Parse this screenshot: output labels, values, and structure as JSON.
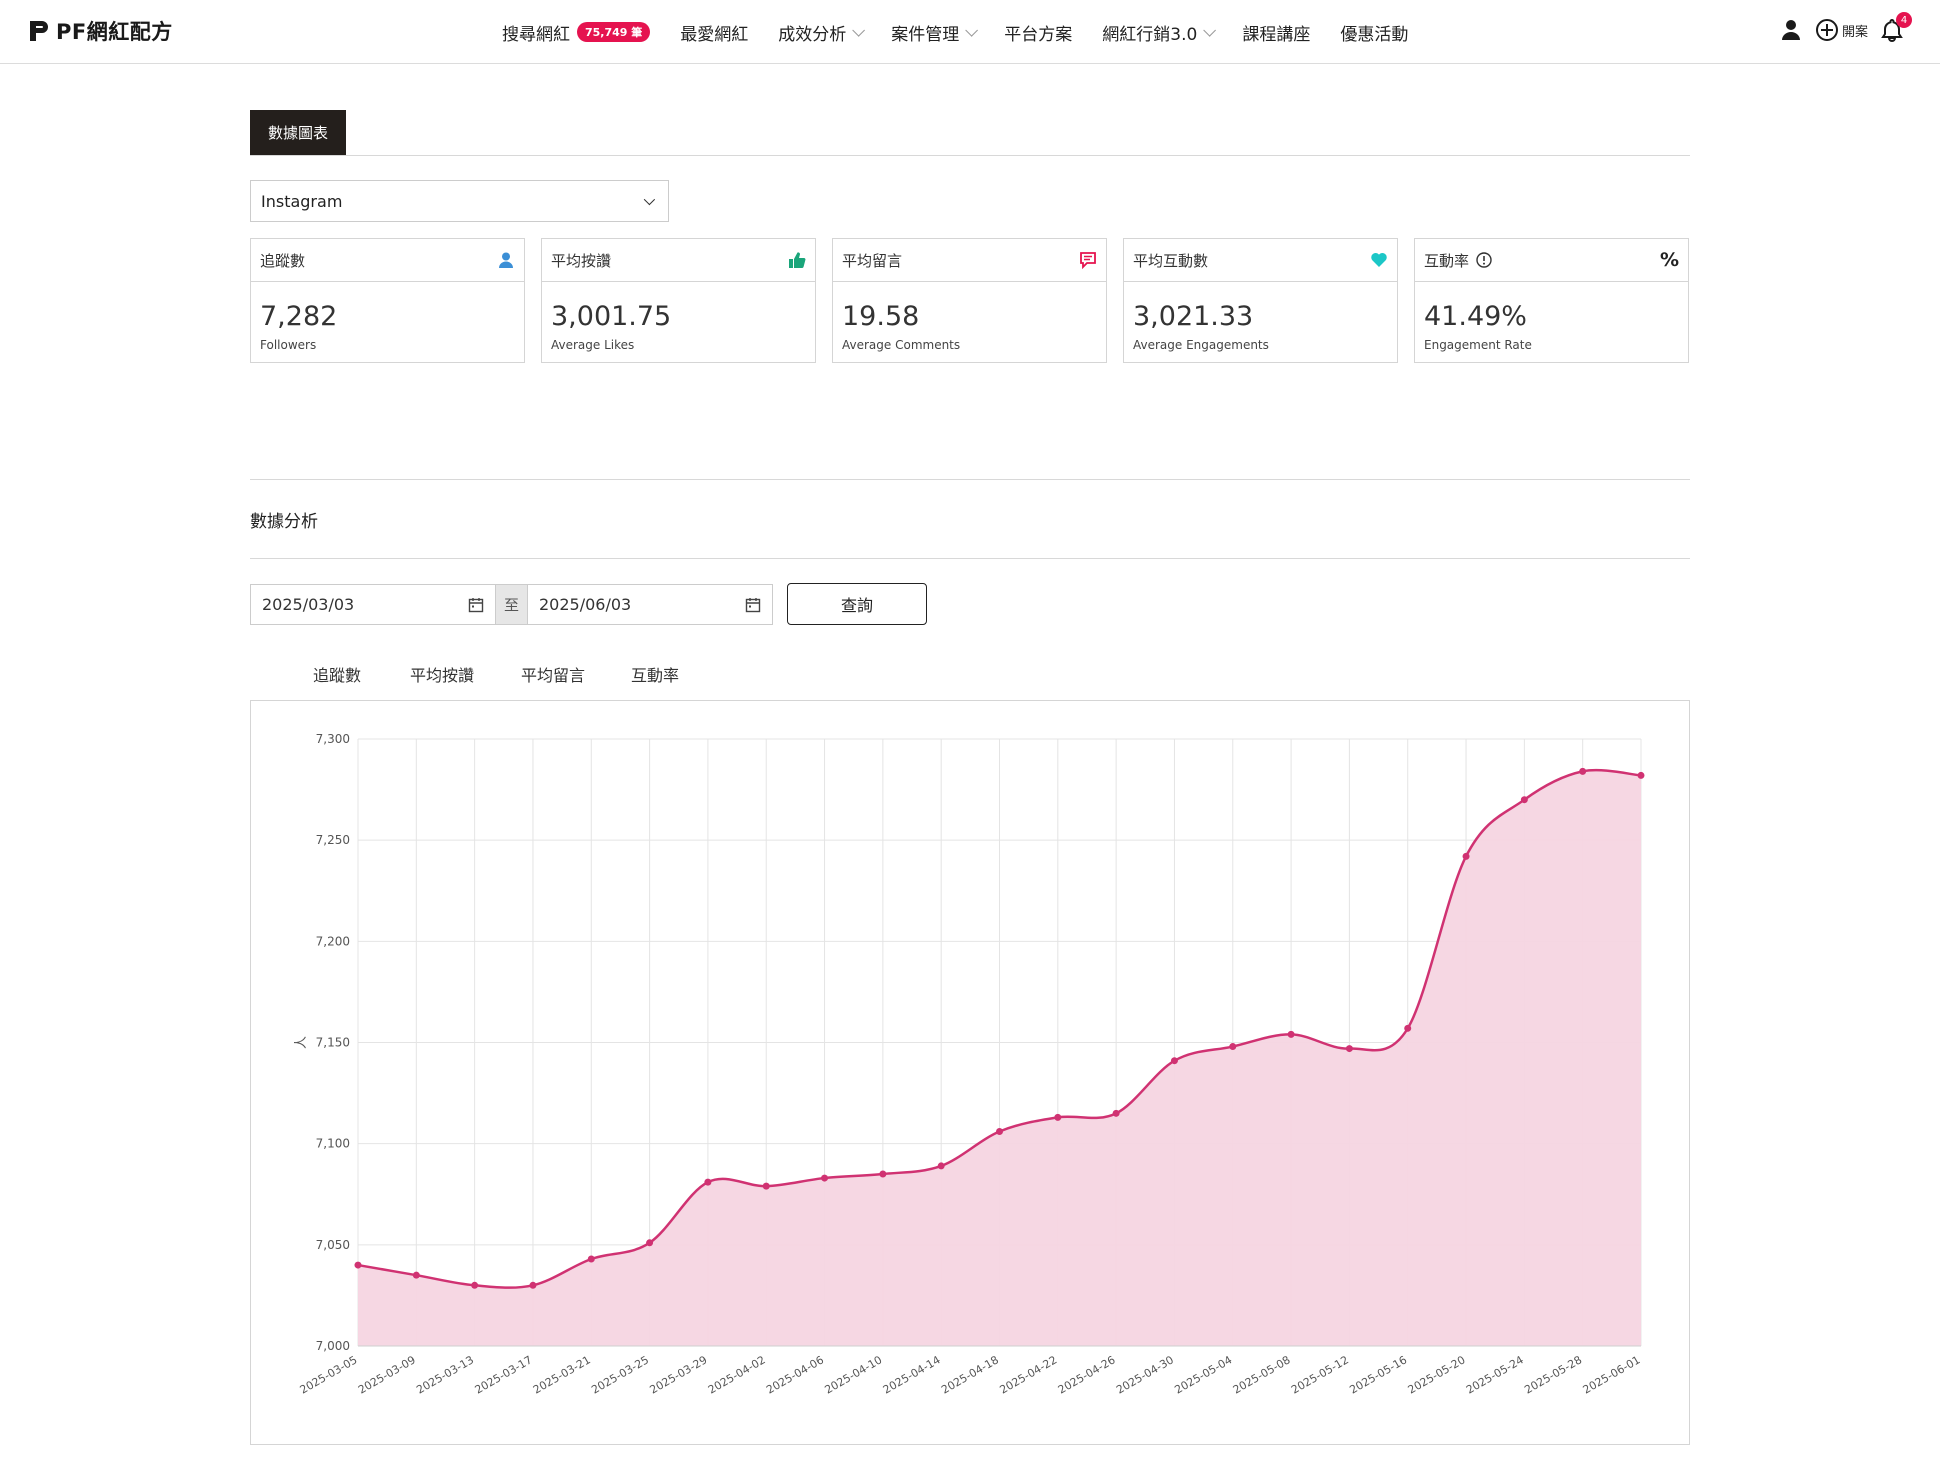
{
  "header": {
    "logo_text": "PF網紅配方",
    "nav": [
      {
        "label": "搜尋網紅",
        "badge": "75,749 筆",
        "dropdown": false
      },
      {
        "label": "最愛網紅",
        "dropdown": false
      },
      {
        "label": "成效分析",
        "dropdown": true
      },
      {
        "label": "案件管理",
        "dropdown": true
      },
      {
        "label": "平台方案",
        "dropdown": false
      },
      {
        "label": "網紅行銷3.0",
        "dropdown": true
      },
      {
        "label": "課程講座",
        "dropdown": false
      },
      {
        "label": "優惠活動",
        "dropdown": false
      }
    ],
    "open_case_label": "開案",
    "notification_count": "4",
    "icons": [
      "user-icon",
      "plus-circle-icon",
      "bell-icon"
    ]
  },
  "section_tab": "數據圖表",
  "platform_select": {
    "value": "Instagram"
  },
  "stats": [
    {
      "label": "追蹤數",
      "value": "7,282",
      "sub": "Followers",
      "icon": "user-icon",
      "color": "#3b8fd6"
    },
    {
      "label": "平均按讚",
      "value": "3,001.75",
      "sub": "Average Likes",
      "icon": "thumbs-up-icon",
      "color": "#1aa57a"
    },
    {
      "label": "平均留言",
      "value": "19.58",
      "sub": "Average Comments",
      "icon": "comment-icon",
      "color": "#e5134f"
    },
    {
      "label": "平均互動數",
      "value": "3,021.33",
      "sub": "Average Engagements",
      "icon": "heart-icon",
      "color": "#1cc7c7"
    },
    {
      "label": "互動率",
      "value": "41.49%",
      "sub": "Engagement Rate",
      "icon": "percent-icon",
      "extra_icon": "info-icon",
      "icon_text": "%",
      "color": "#222222"
    }
  ],
  "analysis": {
    "title": "數據分析",
    "date_from": "2025/03/03",
    "date_sep": "至",
    "date_to": "2025/06/03",
    "query_label": "查詢",
    "tabs": [
      "追蹤數",
      "平均按讚",
      "平均留言",
      "互動率"
    ],
    "active_tab": 0
  },
  "chart_data": {
    "type": "area",
    "ylabel": "人",
    "ylim": [
      7000,
      7300
    ],
    "yticks": [
      7000,
      7050,
      7100,
      7150,
      7200,
      7250,
      7300
    ],
    "grid": true,
    "line_color": "#d03272",
    "fill_color": "#f6d5e1",
    "x": [
      "2025-03-05",
      "2025-03-09",
      "2025-03-13",
      "2025-03-17",
      "2025-03-21",
      "2025-03-25",
      "2025-03-29",
      "2025-04-02",
      "2025-04-06",
      "2025-04-10",
      "2025-04-14",
      "2025-04-18",
      "2025-04-22",
      "2025-04-26",
      "2025-04-30",
      "2025-05-04",
      "2025-05-08",
      "2025-05-12",
      "2025-05-16",
      "2025-05-20",
      "2025-05-24",
      "2025-05-28",
      "2025-06-01"
    ],
    "series": [
      {
        "values": [
          7040,
          7035,
          7030,
          7030,
          7043,
          7051,
          7081,
          7079,
          7083,
          7085,
          7089,
          7106,
          7113,
          7115,
          7141,
          7148,
          7154,
          7147,
          7157,
          7242,
          7270,
          7284,
          7282
        ]
      }
    ]
  }
}
